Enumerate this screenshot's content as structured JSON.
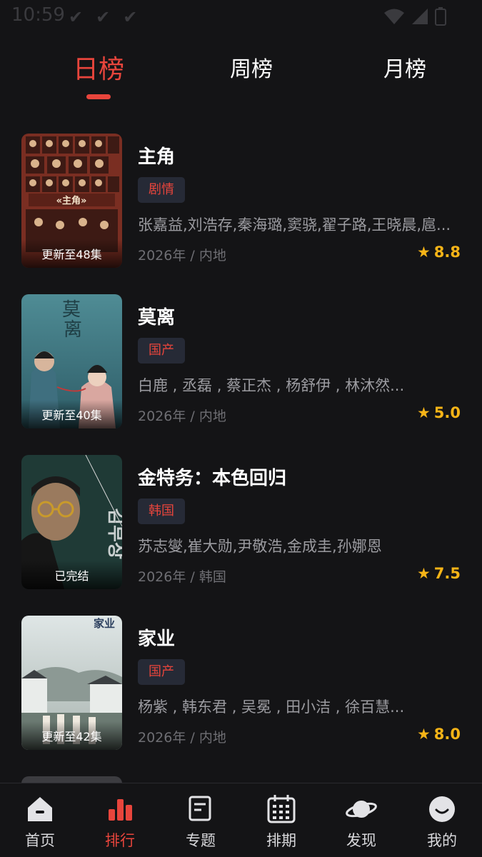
{
  "status_bar": {
    "time": "10:59"
  },
  "tabs": [
    {
      "label": "日榜",
      "active": true
    },
    {
      "label": "周榜",
      "active": false
    },
    {
      "label": "月榜",
      "active": false
    }
  ],
  "colors": {
    "accent": "#e8453c",
    "rating": "#f6b417",
    "background": "#141416"
  },
  "items": [
    {
      "title": "主角",
      "genre": "剧情",
      "cast": "张嘉益,刘浩存,秦海璐,窦骁,翟子路,王晓晨,扈...",
      "meta": "2026年 / 内地",
      "rating": "8.8",
      "badge": "更新至48集"
    },
    {
      "title": "莫离",
      "genre": "国产",
      "cast": "白鹿 , 丞磊 , 蔡正杰 , 杨舒伊 , 林沐然...",
      "meta": "2026年 / 内地",
      "rating": "5.0",
      "badge": "更新至40集"
    },
    {
      "title": "金特务：本色回归",
      "genre": "韩国",
      "cast": "苏志燮,崔大勋,尹敬浩,金成圭,孙娜恩",
      "meta": "2026年 / 韩国",
      "rating": "7.5",
      "badge": "已完结"
    },
    {
      "title": "家业",
      "genre": "国产",
      "cast": "杨紫 , 韩东君 , 吴冕 , 田小洁 , 徐百慧...",
      "meta": "2026年 / 内地",
      "rating": "8.0",
      "badge": "更新至42集"
    }
  ],
  "bottom_nav": [
    {
      "label": "首页",
      "icon": "home-icon",
      "active": false
    },
    {
      "label": "排行",
      "icon": "ranking-icon",
      "active": true
    },
    {
      "label": "专题",
      "icon": "topic-icon",
      "active": false
    },
    {
      "label": "排期",
      "icon": "calendar-icon",
      "active": false
    },
    {
      "label": "发现",
      "icon": "planet-icon",
      "active": false
    },
    {
      "label": "我的",
      "icon": "profile-icon",
      "active": false
    }
  ]
}
